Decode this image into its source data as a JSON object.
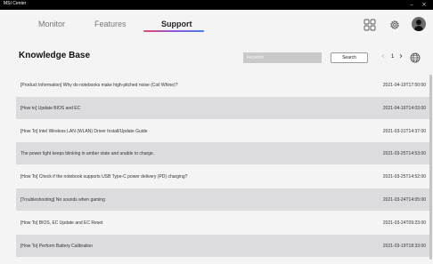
{
  "app": {
    "title": "MSI Center"
  },
  "window_controls": {
    "minimize": "–",
    "close": "×"
  },
  "nav": {
    "tabs": [
      {
        "label": "Monitor",
        "active": false
      },
      {
        "label": "Features",
        "active": false
      },
      {
        "label": "Support",
        "active": true
      }
    ]
  },
  "header_icons": [
    "grid-icon",
    "gear-icon",
    "avatar"
  ],
  "kb": {
    "title": "Knowledge Base",
    "search_placeholder": "keyword",
    "search_label": "Search",
    "page": "1",
    "prev": "‹",
    "next": "›"
  },
  "articles": [
    {
      "title": "[Product Information] Why do notebooks make high-pitched noise (Coil Whine)?",
      "date": "2021-04-19T17:50:00"
    },
    {
      "title": "[How to] Update BIOS and EC",
      "date": "2021-04-16T14:03:00"
    },
    {
      "title": "[How To] Intel Wireless LAN (WLAN) Driver Install/Update Guide",
      "date": "2021-03-31T14:37:00"
    },
    {
      "title": "The power light keeps blinking in amber state and unable to charge.",
      "date": "2021-03-25T14:53:00"
    },
    {
      "title": "[How To] Check if the notebook supports USB Type-C power delivery (PD) charging?",
      "date": "2021-03-25T14:52:00"
    },
    {
      "title": "[Troubleshooting] No sounds when gaming",
      "date": "2021-03-24T14:05:00"
    },
    {
      "title": "[How To] BIOS, EC Update and EC Reset",
      "date": "2021-03-24T09:23:00"
    },
    {
      "title": "[How To] Perform Battery Calibration",
      "date": "2021-03-19T18:33:00"
    }
  ],
  "colors": {
    "accent_gradient": [
      "#e64a6a",
      "#8a5ae0",
      "#4a7de6"
    ],
    "row_alt": "#dcdcde",
    "background": "#f4f4f4"
  }
}
